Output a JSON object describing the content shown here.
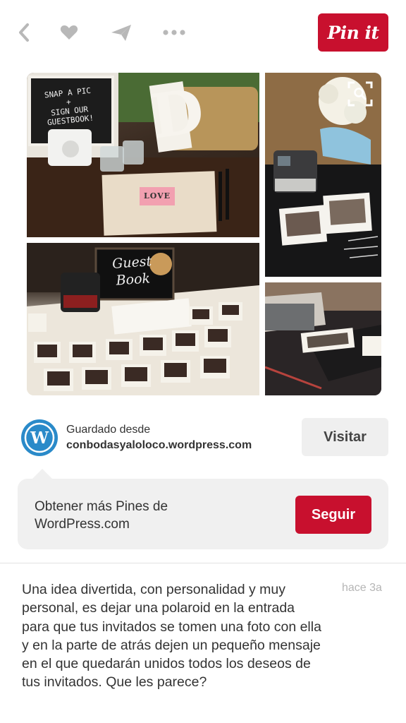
{
  "header": {
    "back_icon": "chevron-left-icon",
    "like_icon": "heart-icon",
    "send_icon": "paper-plane-icon",
    "more_icon": "ellipsis-icon",
    "pinit_label": "Pin it",
    "icon_color": "#b8b8b8",
    "accent": "#c8102e"
  },
  "collage": {
    "expand_icon": "visual-search-icon",
    "tile_1_sign": [
      "SNAP A PIC",
      "+",
      "SIGN OUR",
      "GUESTBOOK!"
    ],
    "tile_1_letter": "D",
    "tile_1_book": "LOVE",
    "tile_3_sign": [
      "Guest",
      "Book"
    ]
  },
  "source": {
    "avatar_icon": "wordpress-icon",
    "saved_label": "Guardado desde",
    "domain": "conbodasyaloloco.wordpress.com",
    "visit_label": "Visitar"
  },
  "follow": {
    "text": "Obtener más Pines de WordPress.com",
    "button_label": "Seguir"
  },
  "description": {
    "text": "Una idea divertida, con personalidad y muy personal, es dejar una polaroid en la entrada para que tus invitados se tomen una foto con ella y en la parte de atrás dejen un pequeño mensaje en el que quedarán unidos todos los deseos de tus invitados. Que les parece?",
    "timestamp": "hace 3a"
  }
}
